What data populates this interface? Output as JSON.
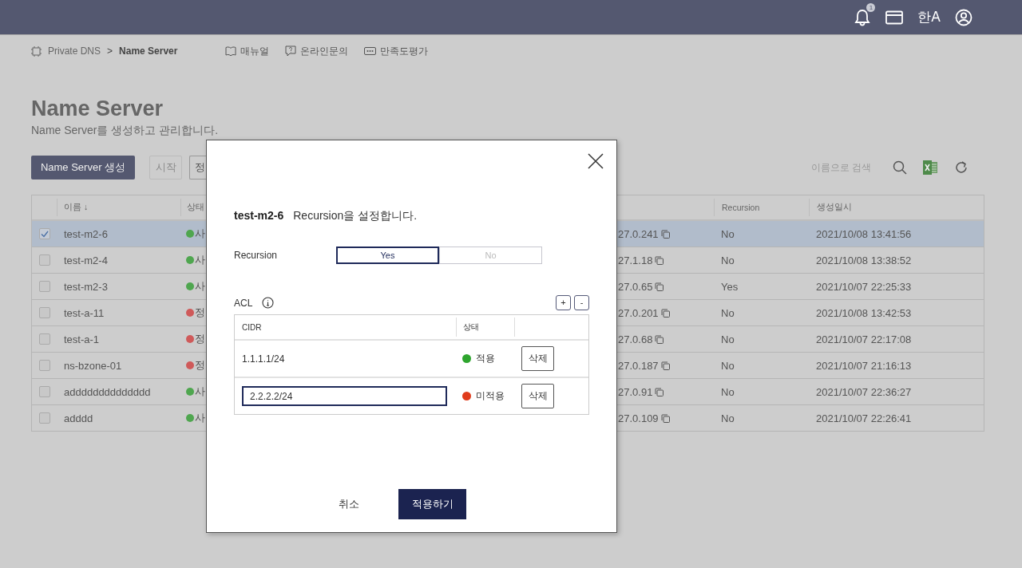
{
  "top_bar": {
    "notification_count": "1",
    "language_label": "한A"
  },
  "breadcrumb": {
    "items": [
      "Private DNS",
      "Name Server"
    ],
    "separator": ">"
  },
  "help_links": [
    {
      "label": "매뉴얼",
      "kind": "manual"
    },
    {
      "label": "온라인문의",
      "kind": "inquiry"
    },
    {
      "label": "만족도평가",
      "kind": "survey"
    }
  ],
  "page": {
    "title": "Name Server",
    "subtitle": "Name Server를 생성하고 관리합니다."
  },
  "toolbar": {
    "buttons": [
      {
        "label": "Name Server 생성",
        "kind": "primary",
        "disabled": false
      },
      {
        "label": "시작",
        "kind": "plain",
        "disabled": true
      },
      {
        "label": "정",
        "kind": "plain",
        "disabled": false
      }
    ],
    "search": {
      "placeholder": "이름으로 검색"
    }
  },
  "table": {
    "columns": [
      {
        "label": "이름",
        "sort": "↓"
      },
      {
        "label": "상태"
      },
      {
        "label": "Recursion"
      },
      {
        "label": "생성일시"
      }
    ],
    "rows": [
      {
        "selected": true,
        "name": "test-m2-6",
        "status": "사",
        "color": "#4fa64f",
        "ip": "27.0.241",
        "recursion": "No",
        "created": "2021/10/08 13:41:56"
      },
      {
        "selected": false,
        "name": "test-m2-4",
        "status": "사",
        "color": "#4fa64f",
        "ip": "27.1.18",
        "recursion": "No",
        "created": "2021/10/08 13:38:52"
      },
      {
        "selected": false,
        "name": "test-m2-3",
        "status": "사",
        "color": "#4fa64f",
        "ip": "27.0.65",
        "recursion": "Yes",
        "created": "2021/10/07 22:25:33"
      },
      {
        "selected": false,
        "name": "test-a-11",
        "status": "정",
        "color": "#cf5a5a",
        "ip": "27.0.201",
        "recursion": "No",
        "created": "2021/10/08 13:42:53"
      },
      {
        "selected": false,
        "name": "test-a-1",
        "status": "정",
        "color": "#cf5a5a",
        "ip": "27.0.68",
        "recursion": "No",
        "created": "2021/10/07 22:17:08"
      },
      {
        "selected": false,
        "name": "ns-bzone-01",
        "status": "정",
        "color": "#cf5a5a",
        "ip": "27.0.187",
        "recursion": "No",
        "created": "2021/10/07 21:16:13"
      },
      {
        "selected": false,
        "name": "adddddddddddddd",
        "status": "사",
        "color": "#4fa64f",
        "ip": "27.0.91",
        "recursion": "No",
        "created": "2021/10/07 22:36:27"
      },
      {
        "selected": false,
        "name": "adddd",
        "status": "사",
        "color": "#4fa64f",
        "ip": "27.0.109",
        "recursion": "No",
        "created": "2021/10/07 22:26:41"
      }
    ]
  },
  "modal": {
    "server_name": "test-m2-6",
    "title": "Recursion을 설정합니다.",
    "recursion_label": "Recursion",
    "recursion_options": [
      {
        "label": "Yes",
        "selected": true
      },
      {
        "label": "No",
        "selected": false
      }
    ],
    "acl_label": "ACL",
    "add_label": "+",
    "remove_label": "-",
    "acl_columns": [
      "CIDR",
      "상태"
    ],
    "acl_rows": [
      {
        "kind": "text",
        "cidr": "1.1.1.1/24",
        "status": "적용",
        "color": "#2ea52e",
        "delete": "삭제"
      },
      {
        "kind": "input",
        "cidr": "2.2.2.2/24",
        "status": "미적용",
        "color": "#e03c1c",
        "delete": "삭제"
      }
    ],
    "cancel": "취소",
    "apply": "적용하기"
  }
}
